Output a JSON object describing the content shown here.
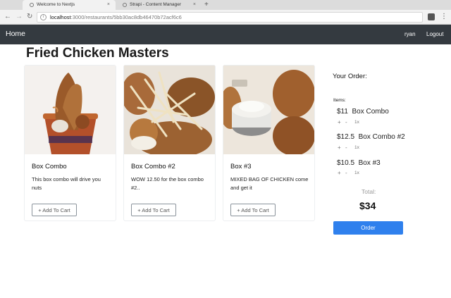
{
  "browser": {
    "tabs": [
      {
        "label": "Welcome to Nextjs"
      },
      {
        "label": "Strapi - Content Manager"
      }
    ],
    "url_host": "localhost",
    "url_rest": ":3000/restaurants/5bb30ac8db46470b72acf6c6"
  },
  "navbar": {
    "brand": "Home",
    "user": "ryan",
    "logout": "Logout"
  },
  "restaurant": {
    "name": "Fried Chicken Masters"
  },
  "dishes": [
    {
      "name": "Box Combo",
      "description": "This box combo will drive you nuts",
      "button": "+ Add To Cart"
    },
    {
      "name": "Box Combo #2",
      "description": "WOW 12.50 for the box combo #2..",
      "button": "+ Add To Cart"
    },
    {
      "name": "Box #3",
      "description": "MIXED BAG OF CHICKEN come and get it",
      "button": "+ Add To Cart"
    }
  ],
  "cart": {
    "title": "Your Order:",
    "items_label": "Items:",
    "items": [
      {
        "price": "$11",
        "name": "Box Combo",
        "plus": "+",
        "minus": "-",
        "qty": "1x"
      },
      {
        "price": "$12.5",
        "name": "Box Combo #2",
        "plus": "+",
        "minus": "-",
        "qty": "1x"
      },
      {
        "price": "$10.5",
        "name": "Box #3",
        "plus": "+",
        "minus": "-",
        "qty": "1x"
      }
    ],
    "total_label": "Total:",
    "total_value": "$34",
    "order_button": "Order"
  },
  "colors": {
    "navbar_bg": "#343a40",
    "order_button_bg": "#2f80ed"
  }
}
